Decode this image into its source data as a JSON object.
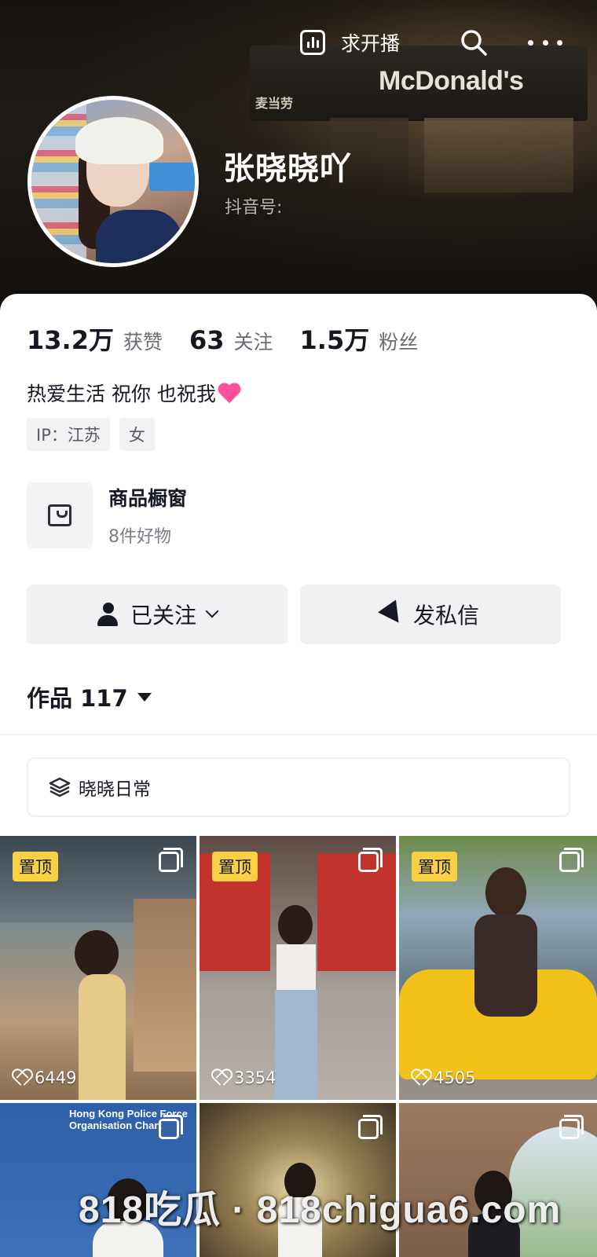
{
  "header": {
    "live_request_label": "求开播",
    "search_icon": "search-icon",
    "more_icon": "more-dots-icon",
    "store_sign": "McDonald's",
    "store_sign_cn": "麦当劳"
  },
  "profile": {
    "nickname": "张晓晓吖",
    "douyin_id_label": "抖音号:",
    "stats": [
      {
        "value": "13.2万",
        "label": "获赞"
      },
      {
        "value": "63",
        "label": "关注"
      },
      {
        "value": "1.5万",
        "label": "粉丝"
      }
    ],
    "bio": "热爱生活 祝你 也祝我",
    "tags": [
      "IP：江苏",
      "女"
    ]
  },
  "shop": {
    "title": "商品橱窗",
    "subtitle": "8件好物"
  },
  "actions": {
    "following_label": "已关注",
    "message_label": "发私信"
  },
  "works": {
    "label": "作品 117",
    "collection_label": "晓晓日常"
  },
  "grid": [
    {
      "badge": "置顶",
      "likes": "6449"
    },
    {
      "badge": "置顶",
      "likes": "3354"
    },
    {
      "badge": "置顶",
      "likes": "4505"
    },
    {
      "overlay_title": "Hong Kong Police Force Organisation Chart"
    },
    {},
    {}
  ],
  "watermark": "818吃瓜 · 818chigua6.com",
  "colors": {
    "pin_badge": "#f7d046",
    "bio_heart": "#ff4f9b",
    "button_bg": "#f1f1f3"
  }
}
